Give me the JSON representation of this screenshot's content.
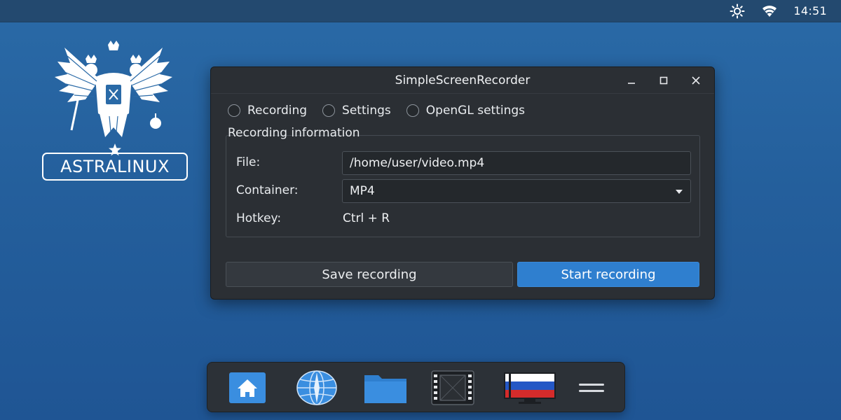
{
  "top_panel": {
    "clock": "14:51",
    "icons": [
      "brightness-icon",
      "wifi-icon"
    ]
  },
  "logo": {
    "text": "ASTRALINUX",
    "emblem": "double-headed-eagle-emblem"
  },
  "window": {
    "title": "SimpleScreenRecorder",
    "controls": [
      "minimize-icon",
      "maximize-icon",
      "close-icon"
    ],
    "tabs": [
      {
        "label": "Recording"
      },
      {
        "label": "Settings"
      },
      {
        "label": "OpenGL settings"
      }
    ],
    "group_title": "Recording information",
    "file": {
      "label": "File:",
      "value": "/home/user/video.mp4"
    },
    "container": {
      "label": "Container:",
      "value": "MP4"
    },
    "hotkey": {
      "label": "Hotkey:",
      "value": "Ctrl + R"
    },
    "buttons": {
      "save": "Save recording",
      "start": "Start recording"
    }
  },
  "dock": {
    "items": [
      "home-icon",
      "globe-browser-icon",
      "folder-icon",
      "video-film-icon",
      "russian-flag-monitor-icon",
      "menu-icon"
    ]
  },
  "colors": {
    "desktop_background": "#245f9c",
    "window_background": "#2b2f34",
    "accent": "#2f7fcf"
  }
}
